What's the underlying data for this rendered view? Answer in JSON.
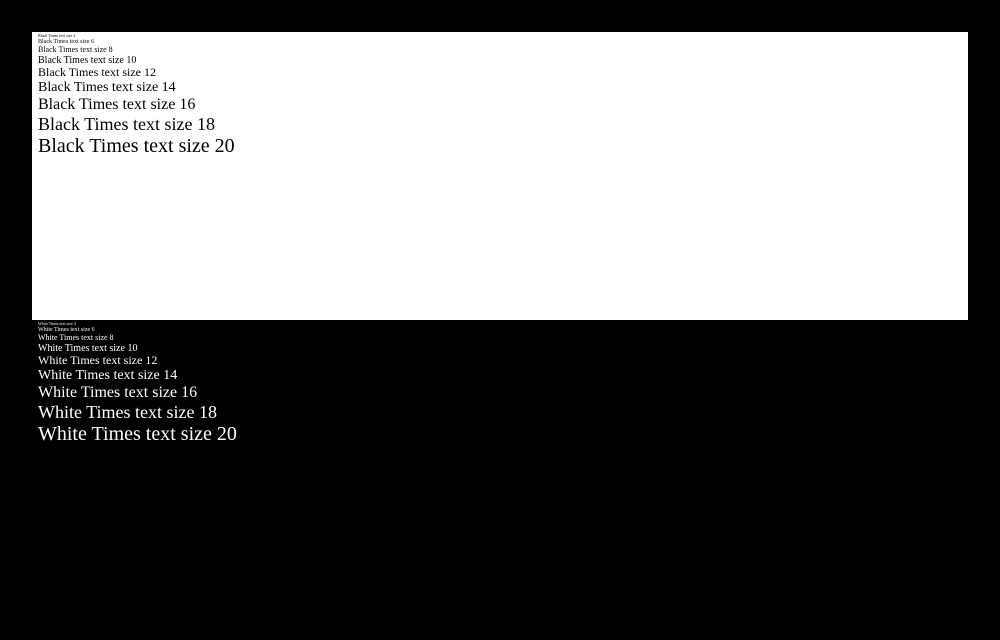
{
  "panels": {
    "white": {
      "lines": [
        {
          "size": 4,
          "text": "Black Times text size 4"
        },
        {
          "size": 6,
          "text": "Black Times text size 6"
        },
        {
          "size": 8,
          "text": "Black Times text size 8"
        },
        {
          "size": 10,
          "text": "Black Times text size 10"
        },
        {
          "size": 12,
          "text": "Black Times text size 12"
        },
        {
          "size": 14,
          "text": "Black Times text size 14"
        },
        {
          "size": 16,
          "text": "Black Times text size 16"
        },
        {
          "size": 18,
          "text": "Black Times text size 18"
        },
        {
          "size": 20,
          "text": "Black Times text size 20"
        }
      ]
    },
    "black": {
      "lines": [
        {
          "size": 4,
          "text": "White Times text size 4"
        },
        {
          "size": 6,
          "text": "White Times text size 6"
        },
        {
          "size": 8,
          "text": "White Times text size 8"
        },
        {
          "size": 10,
          "text": "White Times text size 10"
        },
        {
          "size": 12,
          "text": "White Times text size 12"
        },
        {
          "size": 14,
          "text": "White Times text size 14"
        },
        {
          "size": 16,
          "text": "White Times text size 16"
        },
        {
          "size": 18,
          "text": "White Times text size 18"
        },
        {
          "size": 20,
          "text": "White Times text size 20"
        }
      ]
    }
  }
}
